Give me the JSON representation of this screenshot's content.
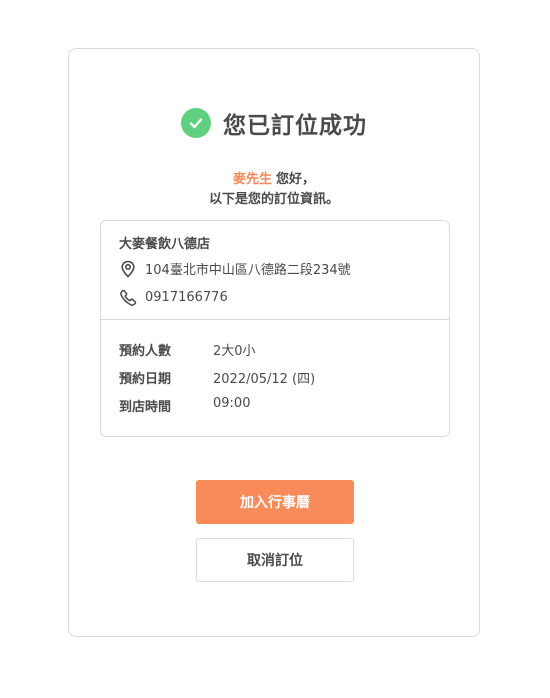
{
  "header": {
    "title": "您已訂位成功"
  },
  "greeting": {
    "customer_name": "麥先生",
    "hello": "您好，",
    "subtitle": "以下是您的訂位資訊。"
  },
  "store": {
    "name": "大麥餐飲八德店",
    "address": "104臺北市中山區八德路二段234號",
    "phone": "0917166776"
  },
  "reservation": {
    "party_label": "預約人數",
    "party_value": "2大0小",
    "date_label": "預約日期",
    "date_value": "2022/05/12 (四)",
    "time_label": "到店時間",
    "time_value": "09:00"
  },
  "actions": {
    "add_calendar_label": "加入行事曆",
    "cancel_label": "取消訂位"
  },
  "colors": {
    "accent": "#f98b5a",
    "name_highlight": "#f28a56",
    "success": "#5fcf80"
  },
  "icons": {
    "success": "check-circle-icon",
    "address": "map-pin-icon",
    "phone": "phone-icon"
  }
}
